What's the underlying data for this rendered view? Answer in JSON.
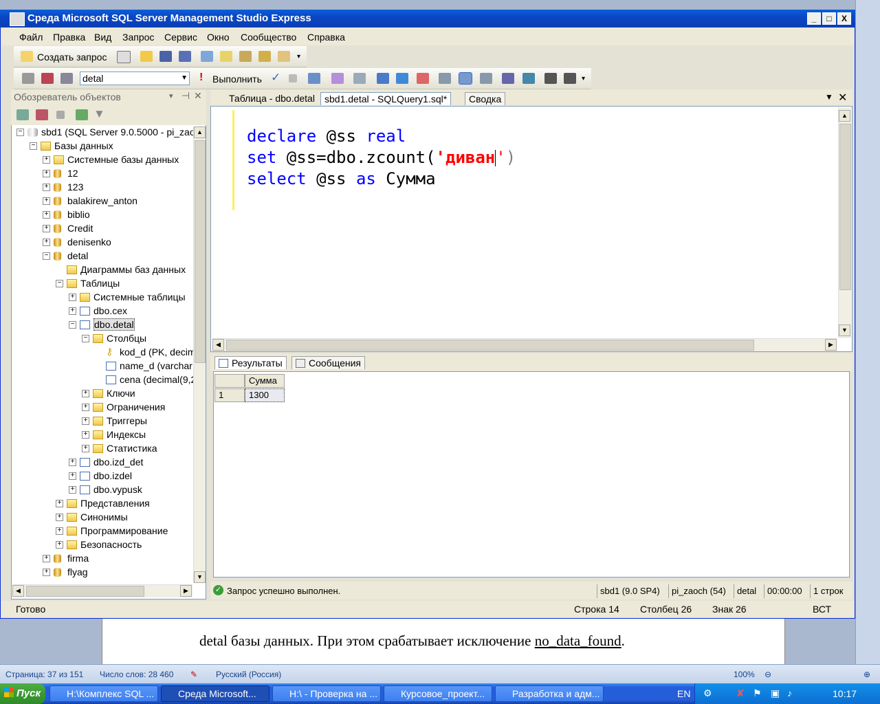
{
  "window": {
    "title": "Среда Microsoft SQL Server Management Studio Express",
    "minimize": "_",
    "maximize": "□",
    "close": "X"
  },
  "menu": [
    "Файл",
    "Правка",
    "Вид",
    "Запрос",
    "Сервис",
    "Окно",
    "Сообщество",
    "Справка"
  ],
  "toolbar1": {
    "new_query": "Создать запрос"
  },
  "toolbar2": {
    "database": "detal",
    "execute": "Выполнить"
  },
  "object_explorer": {
    "title": "Обозреватель объектов",
    "tree": [
      {
        "label": "sbd1 (SQL Server 9.0.5000 - pi_zao",
        "icon": "server-icon",
        "exp": "-"
      },
      {
        "label": "Базы данных",
        "icon": "folder-icon",
        "exp": "-"
      },
      {
        "label": "Системные базы данных",
        "icon": "folder-icon",
        "exp": "+"
      },
      {
        "label": "12",
        "icon": "database-icon",
        "exp": "+"
      },
      {
        "label": "123",
        "icon": "database-icon",
        "exp": "+"
      },
      {
        "label": "balakirew_anton",
        "icon": "database-icon",
        "exp": "+"
      },
      {
        "label": "biblio",
        "icon": "database-icon",
        "exp": "+"
      },
      {
        "label": "Credit",
        "icon": "database-icon",
        "exp": "+"
      },
      {
        "label": "denisenko",
        "icon": "database-icon",
        "exp": "+"
      },
      {
        "label": "detal",
        "icon": "database-icon",
        "exp": "-"
      },
      {
        "label": "Диаграммы баз данных",
        "icon": "folder-icon",
        "exp": ""
      },
      {
        "label": "Таблицы",
        "icon": "folder-icon",
        "exp": "-"
      },
      {
        "label": "Системные таблицы",
        "icon": "folder-icon",
        "exp": "+"
      },
      {
        "label": "dbo.cex",
        "icon": "table-icon",
        "exp": "+"
      },
      {
        "label": "dbo.detal",
        "icon": "table-icon",
        "exp": "-"
      },
      {
        "label": "Столбцы",
        "icon": "folder-icon",
        "exp": "-"
      },
      {
        "label": "kod_d (PK, decim",
        "icon": "key-icon",
        "exp": ""
      },
      {
        "label": "name_d (varchar",
        "icon": "column-icon",
        "exp": ""
      },
      {
        "label": "cena (decimal(9,2",
        "icon": "column-icon",
        "exp": ""
      },
      {
        "label": "Ключи",
        "icon": "folder-icon",
        "exp": "+"
      },
      {
        "label": "Ограничения",
        "icon": "folder-icon",
        "exp": "+"
      },
      {
        "label": "Триггеры",
        "icon": "folder-icon",
        "exp": "+"
      },
      {
        "label": "Индексы",
        "icon": "folder-icon",
        "exp": "+"
      },
      {
        "label": "Статистика",
        "icon": "folder-icon",
        "exp": "+"
      },
      {
        "label": "dbo.izd_det",
        "icon": "table-icon",
        "exp": "+"
      },
      {
        "label": "dbo.izdel",
        "icon": "table-icon",
        "exp": "+"
      },
      {
        "label": "dbo.vypusk",
        "icon": "table-icon",
        "exp": "+"
      },
      {
        "label": "Представления",
        "icon": "folder-icon",
        "exp": "+"
      },
      {
        "label": "Синонимы",
        "icon": "folder-icon",
        "exp": "+"
      },
      {
        "label": "Программирование",
        "icon": "folder-icon",
        "exp": "+"
      },
      {
        "label": "Безопасность",
        "icon": "folder-icon",
        "exp": "+"
      },
      {
        "label": "firma",
        "icon": "database-icon",
        "exp": "+"
      },
      {
        "label": "flyag",
        "icon": "database-icon",
        "exp": "+"
      }
    ]
  },
  "editor": {
    "tabs": [
      "Таблица - dbo.detal",
      "sbd1.detal - SQLQuery1.sql*",
      "Сводка"
    ],
    "line1": {
      "kw1": "declare",
      "var": " @ss ",
      "kw2": "real"
    },
    "line2": {
      "kw": "set",
      "rest": " @ss=dbo.zcount(",
      "str": "'диван",
      "q": "'",
      "end": ")"
    },
    "line3": {
      "kw1": "select",
      "var": " @ss ",
      "kw2": "as",
      "alias": " Сумма"
    }
  },
  "results": {
    "tabs": [
      "Результаты",
      "Сообщения"
    ],
    "column": "Сумма",
    "row_num": "1",
    "value": "1300"
  },
  "query_status": {
    "message": "Запрос успешно выполнен.",
    "server": "sbd1 (9.0 SP4)",
    "user": "pi_zaoch (54)",
    "db": "detal",
    "time": "00:00:00",
    "rows": "1 строк"
  },
  "status": {
    "ready": "Готово",
    "line": "Строка 14",
    "col": "Столбец 26",
    "ch": "Знак 26",
    "ins": "ВСТ"
  },
  "word": {
    "text_a": "detal базы данных. При этом срабатывает исключение ",
    "text_b": "no_data_found",
    "text_c": ".",
    "page": "Страница: 37 из 151",
    "words": "Число слов: 28 460",
    "lang": "Русский (Россия)",
    "zoom": "100%"
  },
  "taskbar": {
    "start": "Пуск",
    "tasks": [
      "H:\\Комплекс SQL ...",
      "Среда Microsoft...",
      "H:\\ - Проверка на ...",
      "Курсовое_проект...",
      "Разработка и адм..."
    ],
    "lang": "EN",
    "clock": "10:17"
  }
}
